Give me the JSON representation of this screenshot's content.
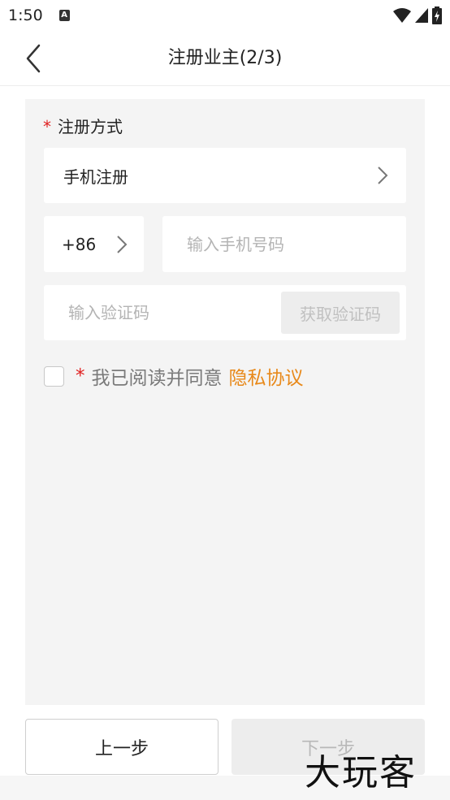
{
  "status_bar": {
    "time": "1:50",
    "notif_icon": "A"
  },
  "header": {
    "title": "注册业主(2/3)",
    "back_icon": "chevron-left-icon"
  },
  "form": {
    "method_label": "注册方式",
    "required_mark": "*",
    "method_value": "手机注册",
    "country_code": "+86",
    "phone_placeholder": "输入手机号码",
    "code_placeholder": "输入验证码",
    "get_code_label": "获取验证码",
    "agree_text": "我已阅读并同意",
    "privacy_link": "隐私协议"
  },
  "footer": {
    "prev_label": "上一步",
    "next_label": "下一步"
  },
  "watermark": "大玩客",
  "colors": {
    "accent": "#e8891a",
    "required": "#e02020",
    "panel_bg": "#f4f4f4"
  }
}
